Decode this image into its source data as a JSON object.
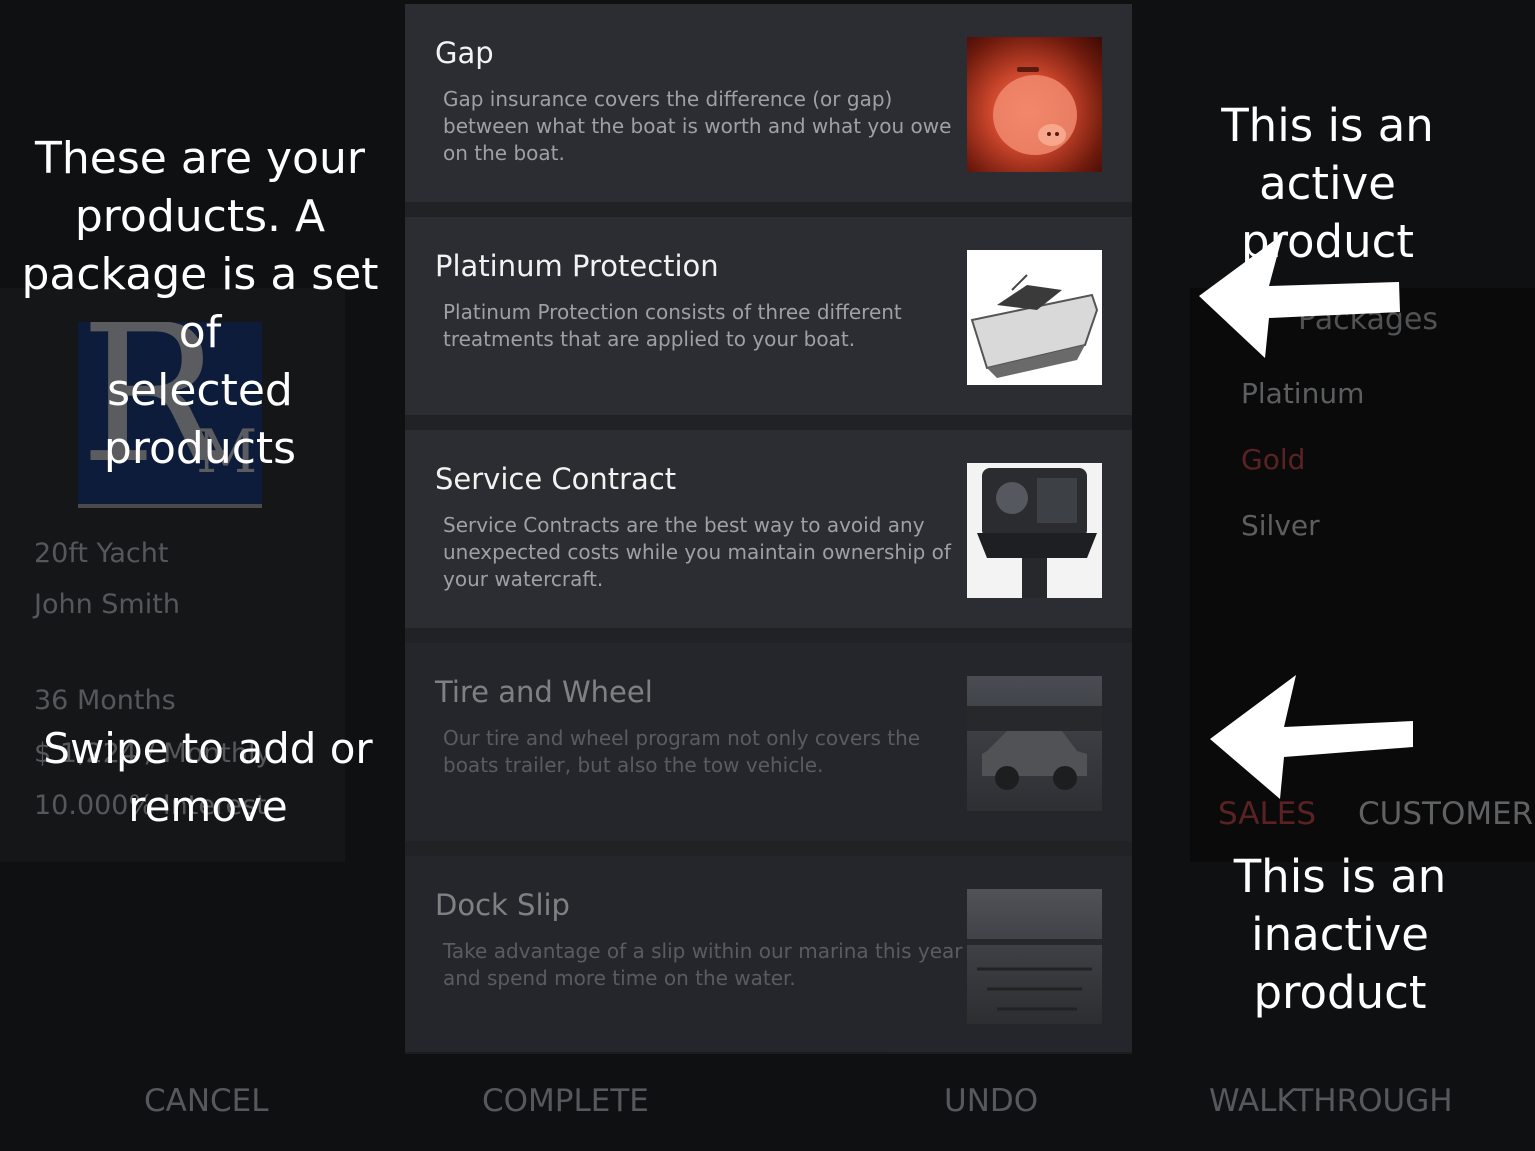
{
  "left_panel": {
    "logo_letters": [
      "R",
      "M"
    ],
    "vehicle": "20ft Yacht",
    "customer_name": "John Smith",
    "term": "36 Months",
    "payment": "$ 1,224 / Monthly",
    "rate": "10.000% Interest"
  },
  "right_panel": {
    "packages_title": "Packages",
    "packages": [
      {
        "label": "Platinum",
        "selected": false
      },
      {
        "label": "Gold",
        "selected": true
      },
      {
        "label": "Silver",
        "selected": false
      }
    ],
    "tabs": {
      "sales": "SALES",
      "customer": "CUSTOMER"
    }
  },
  "products": [
    {
      "title": "Gap",
      "description": "Gap insurance covers the difference (or gap) between what the boat is worth and what you owe on the boat.",
      "image": "piggy-bank",
      "active": true
    },
    {
      "title": "Platinum Protection",
      "description": "Platinum Protection consists of three different treatments that are applied to your boat.",
      "image": "speedboat",
      "active": true
    },
    {
      "title": "Service Contract",
      "description": "Service Contracts are the best way to avoid any unexpected costs while you maintain ownership of your watercraft.",
      "image": "outboard-engine",
      "active": true
    },
    {
      "title": "Tire and Wheel",
      "description": "Our tire and wheel program not only covers the boats trailer, but also the tow vehicle.",
      "image": "suv",
      "active": false
    },
    {
      "title": "Dock Slip",
      "description": "Take advantage of a slip within our marina this year and spend more time on the water.",
      "image": "marina-dock",
      "active": false
    }
  ],
  "bottom_bar": {
    "cancel": "CANCEL",
    "complete": "COMPLETE",
    "undo": "UNDO",
    "walkthrough": "WALKTHROUGH"
  },
  "walkthrough": {
    "products_note_lines": [
      "These are your",
      "products. A",
      "package is a set of",
      "selected products"
    ],
    "swipe_note_lines": [
      "Swipe to add or",
      "remove"
    ],
    "active_note_lines": [
      "This is an active",
      "product"
    ],
    "inactive_note_lines": [
      "This is an",
      "inactive product"
    ],
    "arrow_color": "#ffffff"
  },
  "colors": {
    "background": "#0f1012",
    "card": "#2b2d33",
    "selected_package": "#5a2222"
  }
}
